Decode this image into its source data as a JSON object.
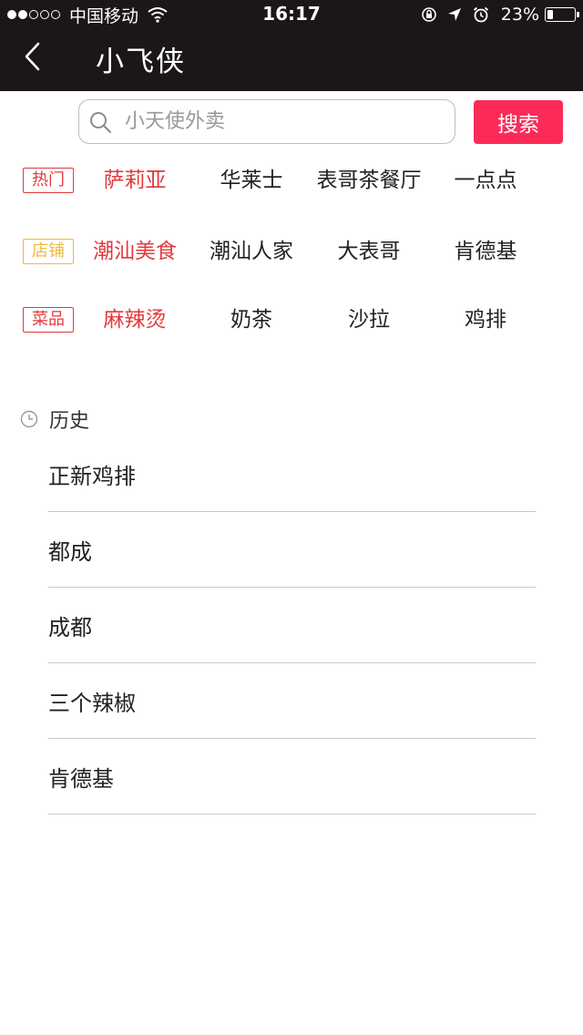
{
  "status_bar": {
    "carrier": "中国移动",
    "time": "16:17",
    "battery_percent": "23%",
    "battery_level": 0.23,
    "signal_dots_filled": 2,
    "signal_dots_total": 5
  },
  "nav": {
    "title": "小飞侠",
    "back_icon": "chevron-left-icon"
  },
  "search": {
    "placeholder": "小天使外卖",
    "value": "",
    "button_label": "搜索",
    "button_color": "#fb2a57",
    "icon": "search-icon"
  },
  "categories": [
    {
      "tag": "热门",
      "tag_color": "#e4393c",
      "items": [
        "萨莉亚",
        "华莱士",
        "表哥茶餐厅",
        "一点点"
      ],
      "highlight_index": 0
    },
    {
      "tag": "店铺",
      "tag_color": "#f0b93a",
      "items": [
        "潮汕美食",
        "潮汕人家",
        "大表哥",
        "肯德基"
      ],
      "highlight_index": 0
    },
    {
      "tag": "菜品",
      "tag_color": "#e4393c",
      "items": [
        "麻辣烫",
        "奶茶",
        "沙拉",
        "鸡排"
      ],
      "highlight_index": 0
    }
  ],
  "highlight_color": "#e4393c",
  "history": {
    "label": "历史",
    "icon": "clock-icon",
    "items": [
      "正新鸡排",
      "都成",
      "成都",
      "三个辣椒",
      "肯德基"
    ]
  }
}
